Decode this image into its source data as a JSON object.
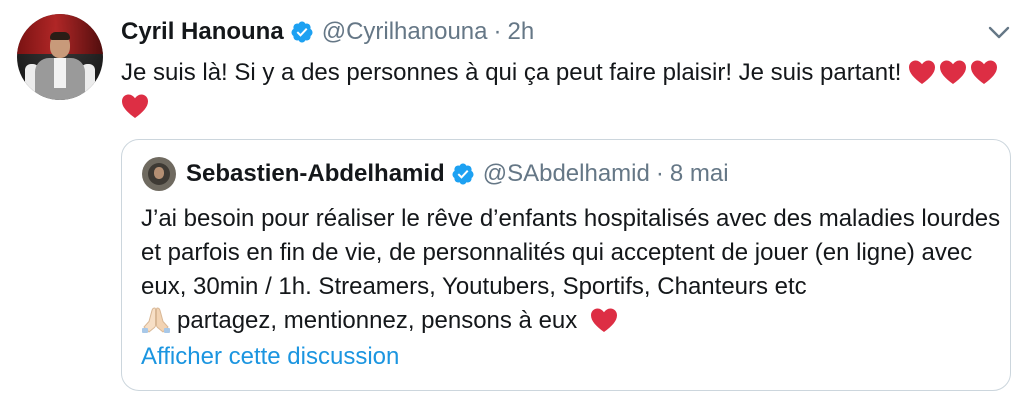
{
  "tweet": {
    "author_name": "Cyril Hanouna",
    "handle": "@Cyrilhanouna",
    "separator": "·",
    "time": "2h",
    "text": "Je suis là! Si y a des personnes à qui ça peut faire plaisir! Je suis partant!",
    "emoji": [
      "red-heart",
      "red-heart",
      "red-heart",
      "red-heart"
    ]
  },
  "quoted_tweet": {
    "author_name": "Sebastien-Abdelhamid",
    "handle": "@SAbdelhamid",
    "separator": "·",
    "time": "8 mai",
    "text": "J’ai besoin pour réaliser le rêve d’enfants hospitalisés avec des maladies lourdes et parfois en fin de vie, de personnalités qui acceptent de jouer (en ligne) avec eux, 30min / 1h. Streamers, Youtubers, Sportifs, Chanteurs etc",
    "text_after_emoji": "partagez, mentionnez, pensons à eux",
    "show_thread_label": "Afficher cette discussion"
  },
  "icons": {
    "verified": "verified-badge-icon",
    "menu": "chevron-down-icon",
    "heart": "red-heart-emoji",
    "pray": "folded-hands-emoji"
  },
  "colors": {
    "verified_blue": "#1da1f2",
    "link_blue": "#1b95e0",
    "secondary_text": "#657786",
    "heart_red": "#dd2e44",
    "border": "#ccd6dd"
  }
}
